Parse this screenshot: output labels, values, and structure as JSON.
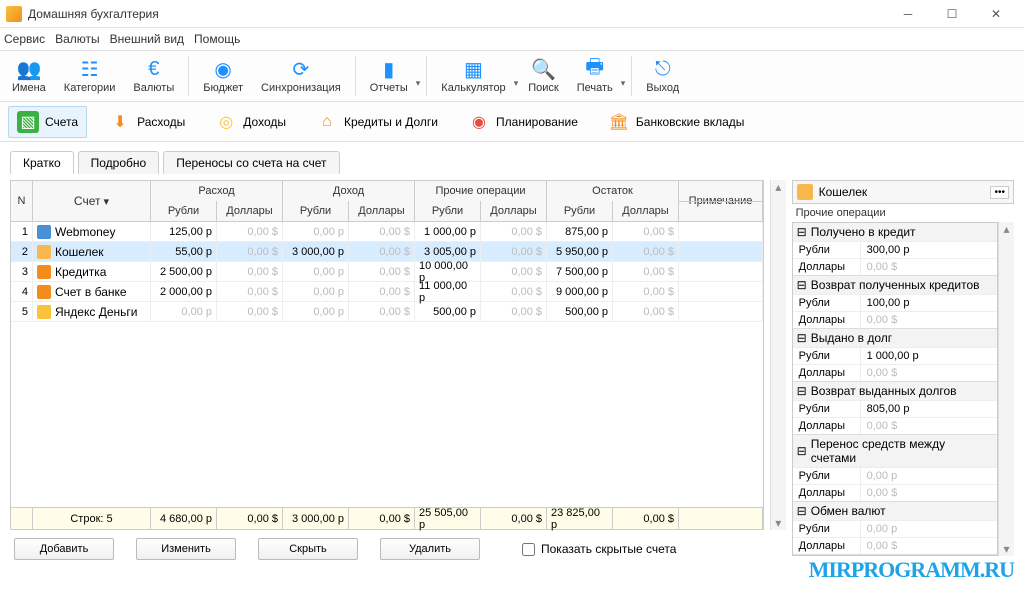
{
  "window": {
    "title": "Домашняя бухгалтерия"
  },
  "menu": {
    "items": [
      "Сервис",
      "Валюты",
      "Внешний вид",
      "Помощь"
    ]
  },
  "toolbar": {
    "items": [
      {
        "label": "Имена",
        "icon": "👥"
      },
      {
        "label": "Категории",
        "icon": "☷"
      },
      {
        "label": "Валюты",
        "icon": "€"
      },
      {
        "label": "Бюджет",
        "icon": "◉"
      },
      {
        "label": "Синхронизация",
        "icon": "⟳"
      },
      {
        "label": "Отчеты",
        "icon": "▮"
      },
      {
        "label": "Калькулятор",
        "icon": "▦"
      },
      {
        "label": "Поиск",
        "icon": "🔍"
      },
      {
        "label": "Печать",
        "icon": "🖶"
      },
      {
        "label": "Выход",
        "icon": "⎋"
      }
    ]
  },
  "navtabs": {
    "items": [
      {
        "label": "Счета",
        "active": true,
        "color": "#3cb043"
      },
      {
        "label": "Расходы",
        "color": "#f28c1c"
      },
      {
        "label": "Доходы",
        "color": "#f9c23c"
      },
      {
        "label": "Кредиты и Долги",
        "color": "#f28c1c"
      },
      {
        "label": "Планирование",
        "color": "#e84c3d"
      },
      {
        "label": "Банковские вклады",
        "color": "#f28c1c"
      }
    ]
  },
  "viewtabs": {
    "items": [
      "Кратко",
      "Подробно",
      "Переносы со счета на счет"
    ],
    "active": 0
  },
  "table": {
    "headers": {
      "n": "N",
      "account": "Счет",
      "expense": "Расход",
      "income": "Доход",
      "other": "Прочие операции",
      "balance": "Остаток",
      "rub": "Рубли",
      "usd": "Доллары",
      "note": "Примечание"
    },
    "rows": [
      {
        "n": "1",
        "name": "Webmoney",
        "iconColor": "#4a90d9",
        "exp_r": "125,00 р",
        "exp_d": "0,00 $",
        "inc_r": "0,00 р",
        "inc_d": "0,00 $",
        "oth_r": "1 000,00 р",
        "oth_d": "0,00 $",
        "bal_r": "875,00 р",
        "bal_d": "0,00 $",
        "sel": false
      },
      {
        "n": "2",
        "name": "Кошелек",
        "iconColor": "#f8b84e",
        "exp_r": "55,00 р",
        "exp_d": "0,00 $",
        "inc_r": "3 000,00 р",
        "inc_d": "0,00 $",
        "oth_r": "3 005,00 р",
        "oth_d": "0,00 $",
        "bal_r": "5 950,00 р",
        "bal_d": "0,00 $",
        "sel": true
      },
      {
        "n": "3",
        "name": "Кредитка",
        "iconColor": "#f28c1c",
        "exp_r": "2 500,00 р",
        "exp_d": "0,00 $",
        "inc_r": "0,00 р",
        "inc_d": "0,00 $",
        "oth_r": "10 000,00 р",
        "oth_d": "0,00 $",
        "bal_r": "7 500,00 р",
        "bal_d": "0,00 $",
        "sel": false
      },
      {
        "n": "4",
        "name": "Счет в банке",
        "iconColor": "#f28c1c",
        "exp_r": "2 000,00 р",
        "exp_d": "0,00 $",
        "inc_r": "0,00 р",
        "inc_d": "0,00 $",
        "oth_r": "11 000,00 р",
        "oth_d": "0,00 $",
        "bal_r": "9 000,00 р",
        "bal_d": "0,00 $",
        "sel": false
      },
      {
        "n": "5",
        "name": "Яндекс Деньги",
        "iconColor": "#f9c23c",
        "exp_r": "0,00 р",
        "exp_d": "0,00 $",
        "inc_r": "0,00 р",
        "inc_d": "0,00 $",
        "oth_r": "500,00 р",
        "oth_d": "0,00 $",
        "bal_r": "500,00 р",
        "bal_d": "0,00 $",
        "sel": false
      }
    ],
    "footer": {
      "label": "Строк: 5",
      "exp_r": "4 680,00 р",
      "exp_d": "0,00 $",
      "inc_r": "3 000,00 р",
      "inc_d": "0,00 $",
      "oth_r": "25 505,00 р",
      "oth_d": "0,00 $",
      "bal_r": "23 825,00 р",
      "bal_d": "0,00 $"
    }
  },
  "side": {
    "title": "Кошелек",
    "subtitle": "Прочие операции",
    "groups": [
      {
        "head": "Получено в кредит",
        "rows": [
          {
            "k": "Рубли",
            "v": "300,00 р"
          },
          {
            "k": "Доллары",
            "v": "0,00 $",
            "dim": true
          }
        ]
      },
      {
        "head": "Возврат полученных кредитов",
        "rows": [
          {
            "k": "Рубли",
            "v": "100,00 р"
          },
          {
            "k": "Доллары",
            "v": "0,00 $",
            "dim": true
          }
        ]
      },
      {
        "head": "Выдано в долг",
        "rows": [
          {
            "k": "Рубли",
            "v": "1 000,00 р"
          },
          {
            "k": "Доллары",
            "v": "0,00 $",
            "dim": true
          }
        ]
      },
      {
        "head": "Возврат выданных долгов",
        "rows": [
          {
            "k": "Рубли",
            "v": "805,00 р"
          },
          {
            "k": "Доллары",
            "v": "0,00 $",
            "dim": true
          }
        ]
      },
      {
        "head": "Перенос средств между счетами",
        "rows": [
          {
            "k": "Рубли",
            "v": "0,00 р",
            "dim": true
          },
          {
            "k": "Доллары",
            "v": "0,00 $",
            "dim": true
          }
        ]
      },
      {
        "head": "Обмен валют",
        "rows": [
          {
            "k": "Рубли",
            "v": "0,00 р",
            "dim": true
          },
          {
            "k": "Доллары",
            "v": "0,00 $",
            "dim": true
          }
        ]
      }
    ]
  },
  "bottom": {
    "add": "Добавить",
    "edit": "Изменить",
    "hide": "Скрыть",
    "delete": "Удалить",
    "show_hidden": "Показать скрытые счета"
  },
  "watermark": "MIRPROGRAMM.RU"
}
